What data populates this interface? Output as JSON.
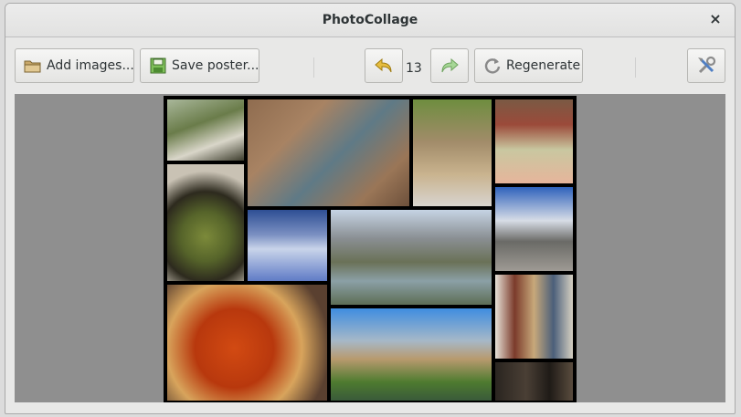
{
  "window": {
    "title": "PhotoCollage",
    "close_glyph": "×"
  },
  "toolbar": {
    "add_images_label": "Add images...",
    "save_poster_label": "Save poster...",
    "history_count": "13",
    "regenerate_label": "Regenerate"
  },
  "icons": {
    "add_images": "folder-icon",
    "save_poster": "save-image-icon",
    "undo": "undo-arrow-icon",
    "redo": "redo-arrow-icon",
    "regenerate": "refresh-icon",
    "settings": "tools-icon"
  },
  "colors": {
    "canvas_background": "#8f8f8f",
    "poster_border": "#000000",
    "undo_arrow": "#e0b43a",
    "redo_arrow": "#9bd08a"
  }
}
